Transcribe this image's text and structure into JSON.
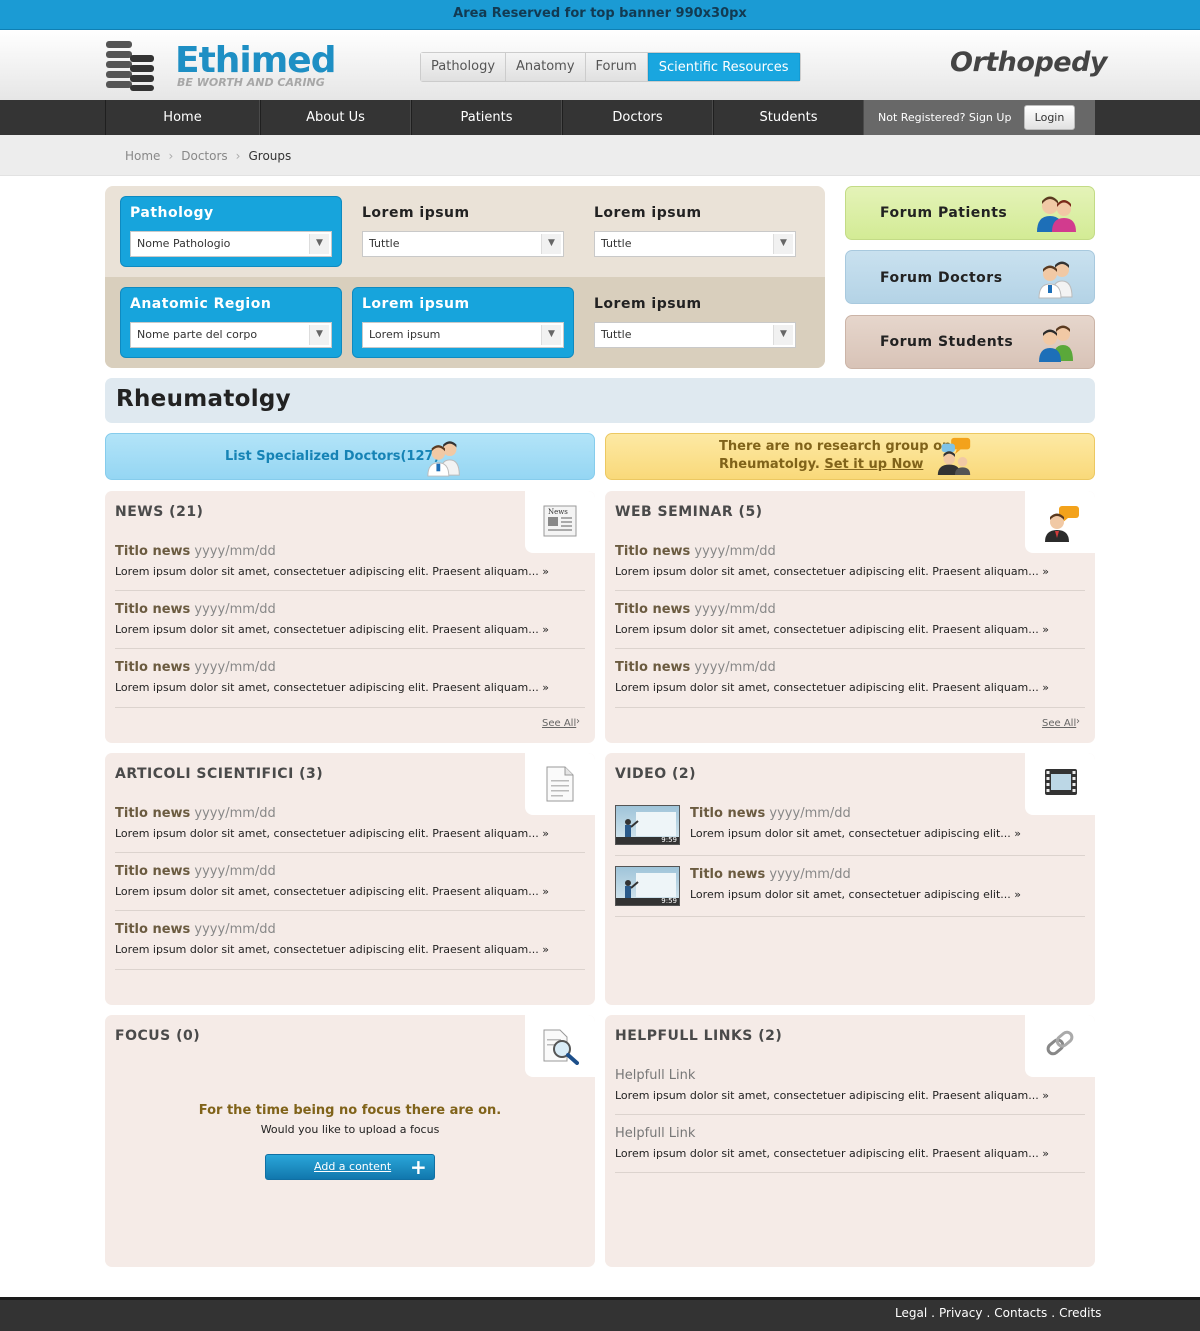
{
  "banner": {
    "text": "Area Reserved for top banner 990x30px"
  },
  "header": {
    "logo_text": "Ethimed",
    "logo_tagline": "BE WORTH AND CARING",
    "specialty": "Orthopedy",
    "top_nav": [
      "Pathology",
      "Anatomy",
      "Forum",
      "Scientific Resources"
    ],
    "top_nav_active": "Scientific Resources"
  },
  "main_nav": {
    "items": [
      "Home",
      "About Us",
      "Patients",
      "Doctors",
      "Students"
    ],
    "signup_text": "Not Registered? Sign Up",
    "login_label": "Login"
  },
  "breadcrumb": {
    "items": [
      "Home",
      "Doctors",
      "Groups"
    ],
    "separator": "›"
  },
  "filters": {
    "pathology": {
      "label": "Pathology",
      "value": "Nome Pathologio"
    },
    "f2": {
      "label": "Lorem ipsum",
      "value": "Tuttle"
    },
    "f3": {
      "label": "Lorem ipsum",
      "value": "Tuttle"
    },
    "anatomic": {
      "label": "Anatomic Region",
      "value": "Nome parte del corpo"
    },
    "f5": {
      "label": "Lorem ipsum",
      "value": "Lorem ipsum"
    },
    "f6": {
      "label": "Lorem ipsum",
      "value": "Tuttle"
    }
  },
  "forums": {
    "patients": "Forum Patients",
    "doctors": "Forum Doctors",
    "students": "Forum Students"
  },
  "section_title": "Rheumatolgy",
  "doctors_link": "List Specialized Doctors(127)",
  "research": {
    "line1": "There are no research group on",
    "line2_prefix": "Rheumatolgy.",
    "link": "Set it up Now"
  },
  "news": {
    "title": "NEWS (21)",
    "items": [
      {
        "title": "Titlo news",
        "date": "yyyy/mm/dd",
        "text": "Lorem ipsum dolor sit amet, consectetuer adipiscing elit. Praesent aliquam... »"
      },
      {
        "title": "Titlo news",
        "date": "yyyy/mm/dd",
        "text": "Lorem ipsum dolor sit amet, consectetuer adipiscing elit. Praesent aliquam... »"
      },
      {
        "title": "Titlo news",
        "date": "yyyy/mm/dd",
        "text": "Lorem ipsum dolor sit amet, consectetuer adipiscing elit. Praesent aliquam... »"
      }
    ],
    "see_all": "See All"
  },
  "seminar": {
    "title": "WEB SEMINAR (5)",
    "items": [
      {
        "title": "Titlo news",
        "date": "yyyy/mm/dd",
        "text": "Lorem ipsum dolor sit amet, consectetuer adipiscing elit. Praesent aliquam... »"
      },
      {
        "title": "Titlo news",
        "date": "yyyy/mm/dd",
        "text": "Lorem ipsum dolor sit amet, consectetuer adipiscing elit. Praesent aliquam... »"
      },
      {
        "title": "Titlo news",
        "date": "yyyy/mm/dd",
        "text": "Lorem ipsum dolor sit amet, consectetuer adipiscing elit. Praesent aliquam... »"
      }
    ],
    "see_all": "See All"
  },
  "articles": {
    "title": "ARTICOLI SCIENTIFICI (3)",
    "items": [
      {
        "title": "Titlo news",
        "date": "yyyy/mm/dd",
        "text": "Lorem ipsum dolor sit amet, consectetuer adipiscing elit. Praesent aliquam... »"
      },
      {
        "title": "Titlo news",
        "date": "yyyy/mm/dd",
        "text": "Lorem ipsum dolor sit amet, consectetuer adipiscing elit. Praesent aliquam... »"
      },
      {
        "title": "Titlo news",
        "date": "yyyy/mm/dd",
        "text": "Lorem ipsum dolor sit amet, consectetuer adipiscing elit. Praesent aliquam... »"
      }
    ]
  },
  "video": {
    "title": "VIDEO (2)",
    "items": [
      {
        "title": "Titlo news",
        "date": "yyyy/mm/dd",
        "text": "Lorem ipsum dolor sit amet, consectetuer adipiscing elit... »",
        "duration": "9:59"
      },
      {
        "title": "Titlo news",
        "date": "yyyy/mm/dd",
        "text": "Lorem ipsum dolor sit amet, consectetuer adipiscing elit... »",
        "duration": "9:59"
      }
    ]
  },
  "focus": {
    "title": "FOCUS (0)",
    "message": "For the time being no focus there are on.",
    "sub": "Would you like to upload a focus",
    "button": "Add a content"
  },
  "links": {
    "title": "HELPFULL LINKS (2)",
    "items": [
      {
        "title": "Helpfull Link",
        "text": "Lorem ipsum dolor sit amet, consectetuer adipiscing elit. Praesent aliquam... »"
      },
      {
        "title": "Helpfull Link",
        "text": "Lorem ipsum dolor sit amet, consectetuer adipiscing elit. Praesent aliquam... »"
      }
    ]
  },
  "footer": {
    "links": [
      "Legal",
      "Privacy",
      "Contacts",
      "Credits"
    ],
    "separator": "."
  },
  "colors": {
    "accent": "#19a6df",
    "panel": "#f5ebe7",
    "nav": "#343434"
  }
}
